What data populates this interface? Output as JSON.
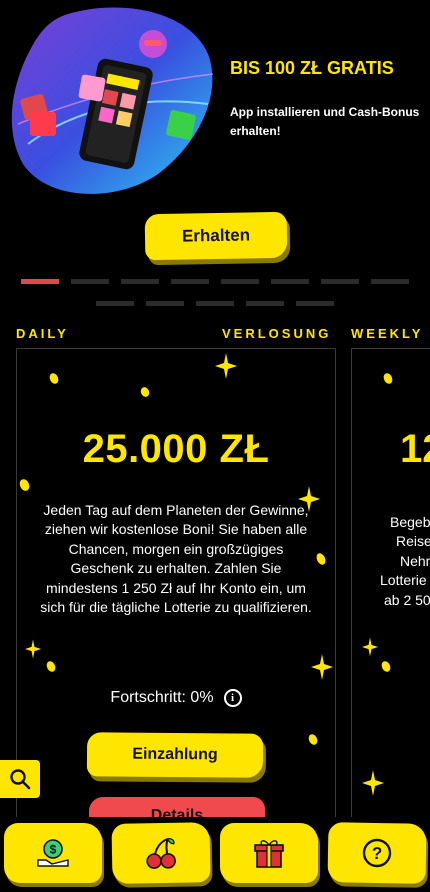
{
  "promo": {
    "title": "BIS 100 ZŁ GRATIS",
    "subtitle": "App installieren und Cash-Bonus erhalten!",
    "cta_label": "Erhalten"
  },
  "pager": {
    "total": 13,
    "active_index": 0
  },
  "lotteries": [
    {
      "period_label": "DAILY",
      "type_label": "VERLOSUNG",
      "prize": "25.000 ZŁ",
      "description": "Jeden Tag auf dem Planeten der Gewinne, ziehen wir kostenlose Boni! Sie haben alle Chancen, morgen ein großzügiges Geschenk zu erhalten. Zahlen Sie mindestens 1 250 Zł auf Ihr Konto ein, um sich für die tägliche Lotterie zu qualifizieren.",
      "progress_label": "Fortschritt: 0%",
      "deposit_label": "Einzahlung",
      "details_label": "Details"
    },
    {
      "period_label": "WEEKLY",
      "prize_partial": "12",
      "description_lines": [
        "Begeb",
        "Reise",
        "Nehm",
        "Lotterie",
        "ab 2 50"
      ]
    }
  ],
  "icons": {
    "search": "search-icon",
    "info": "info-icon",
    "nav": [
      "cashback-icon",
      "cherries-icon",
      "gift-icon",
      "help-icon"
    ]
  },
  "colors": {
    "accent": "#ffe600",
    "active": "#e0484c",
    "danger": "#f04a4e",
    "background": "#000000"
  }
}
